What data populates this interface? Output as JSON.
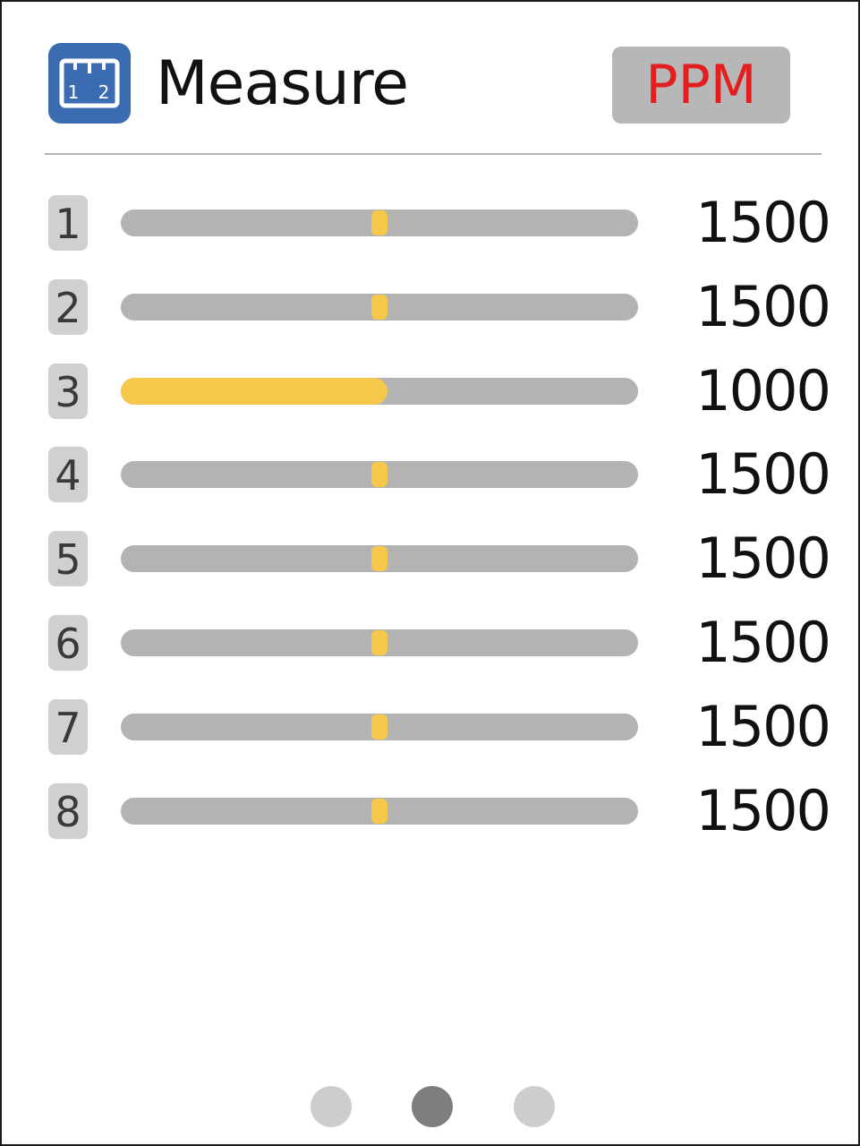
{
  "header": {
    "title": "Measure",
    "unit_label": "PPM",
    "icon": "ruler-icon",
    "icon_digits": [
      "1",
      "2"
    ]
  },
  "channels": [
    {
      "index": "1",
      "value": "1500",
      "level": 0.5,
      "mode": "marker"
    },
    {
      "index": "2",
      "value": "1500",
      "level": 0.5,
      "mode": "marker"
    },
    {
      "index": "3",
      "value": "1000",
      "level": 0.5,
      "mode": "fill"
    },
    {
      "index": "4",
      "value": "1500",
      "level": 0.5,
      "mode": "marker"
    },
    {
      "index": "5",
      "value": "1500",
      "level": 0.5,
      "mode": "marker"
    },
    {
      "index": "6",
      "value": "1500",
      "level": 0.5,
      "mode": "marker"
    },
    {
      "index": "7",
      "value": "1500",
      "level": 0.5,
      "mode": "marker"
    },
    {
      "index": "8",
      "value": "1500",
      "level": 0.5,
      "mode": "marker"
    }
  ],
  "pager": {
    "pages": 3,
    "active": 1
  },
  "colors": {
    "icon_bg": "#3b6bb1",
    "unit_text": "#e21e1e",
    "unit_bg": "#b7b7b7",
    "track": "#b3b3b3",
    "accent": "#f5c84c",
    "dot": "#cdcdcd",
    "dot_active": "#7e7e7e"
  }
}
